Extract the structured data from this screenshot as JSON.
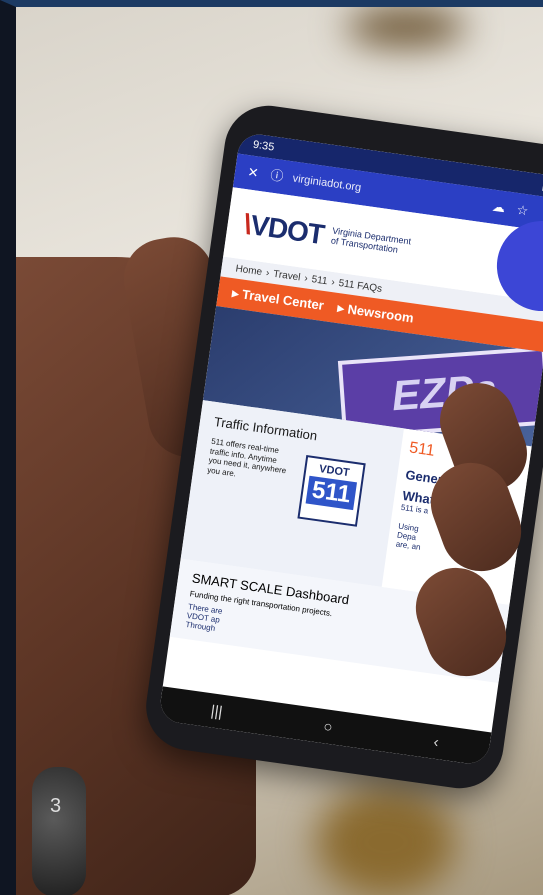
{
  "status": {
    "time": "9:35"
  },
  "browser": {
    "url": "virginiadot.org"
  },
  "site": {
    "logo": "VDOT",
    "logo_sub_1": "Virginia Department",
    "logo_sub_2": "of Transportation",
    "breadcrumbs": [
      "Home",
      "Travel",
      "511",
      "511 FAQs"
    ],
    "nav": [
      "Travel Center",
      "Newsroom"
    ],
    "hero_text": "EZPa",
    "traffic_title": "Traffic Information",
    "traffic_body": "511 offers real-time traffic info. Anytime you need it, anywhere you are.",
    "badge_top": "VDOT",
    "badge_num": "511",
    "right_num": "511",
    "right_1": "Gener",
    "right_2": "What",
    "right_3": "511 is a",
    "right_4": "Using",
    "right_5": "Depa",
    "right_6": "are, an",
    "right_7": "There are",
    "right_8": "VDOT ap",
    "right_9": "Through",
    "smart_title": "SMART SCALE Dashboard",
    "smart_body": "Funding the right transportation projects."
  },
  "watch_text": "3"
}
